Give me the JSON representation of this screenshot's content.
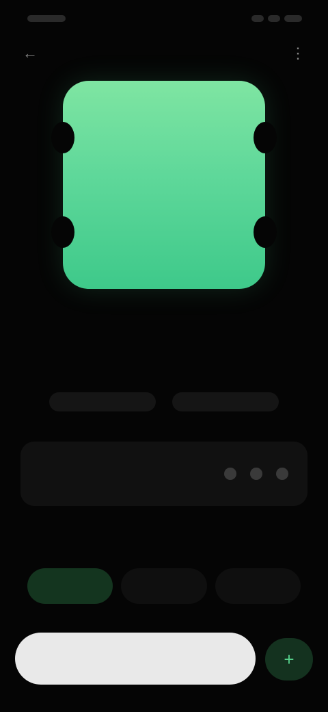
{
  "status_bar": {
    "time": "",
    "indicators": [
      "signal-icon",
      "wifi-icon",
      "battery-icon"
    ]
  },
  "top_bar": {
    "back_icon": "arrow-left-icon",
    "more_icon": "more-vertical-icon"
  },
  "hero": {
    "art_color": "#5fd89a",
    "title": "",
    "subtitle": ""
  },
  "meta": {
    "left_label": "",
    "right_label": ""
  },
  "card": {
    "label": "",
    "dots": 3
  },
  "section": {
    "label": ""
  },
  "segments": [
    {
      "label": "",
      "active": true
    },
    {
      "label": "",
      "active": false
    },
    {
      "label": "",
      "active": false
    }
  ],
  "actions": {
    "primary_label": "",
    "fab_icon": "plus-icon"
  },
  "colors": {
    "background": "#050505",
    "accent": "#2ec27e",
    "art": "#5fd89a"
  }
}
